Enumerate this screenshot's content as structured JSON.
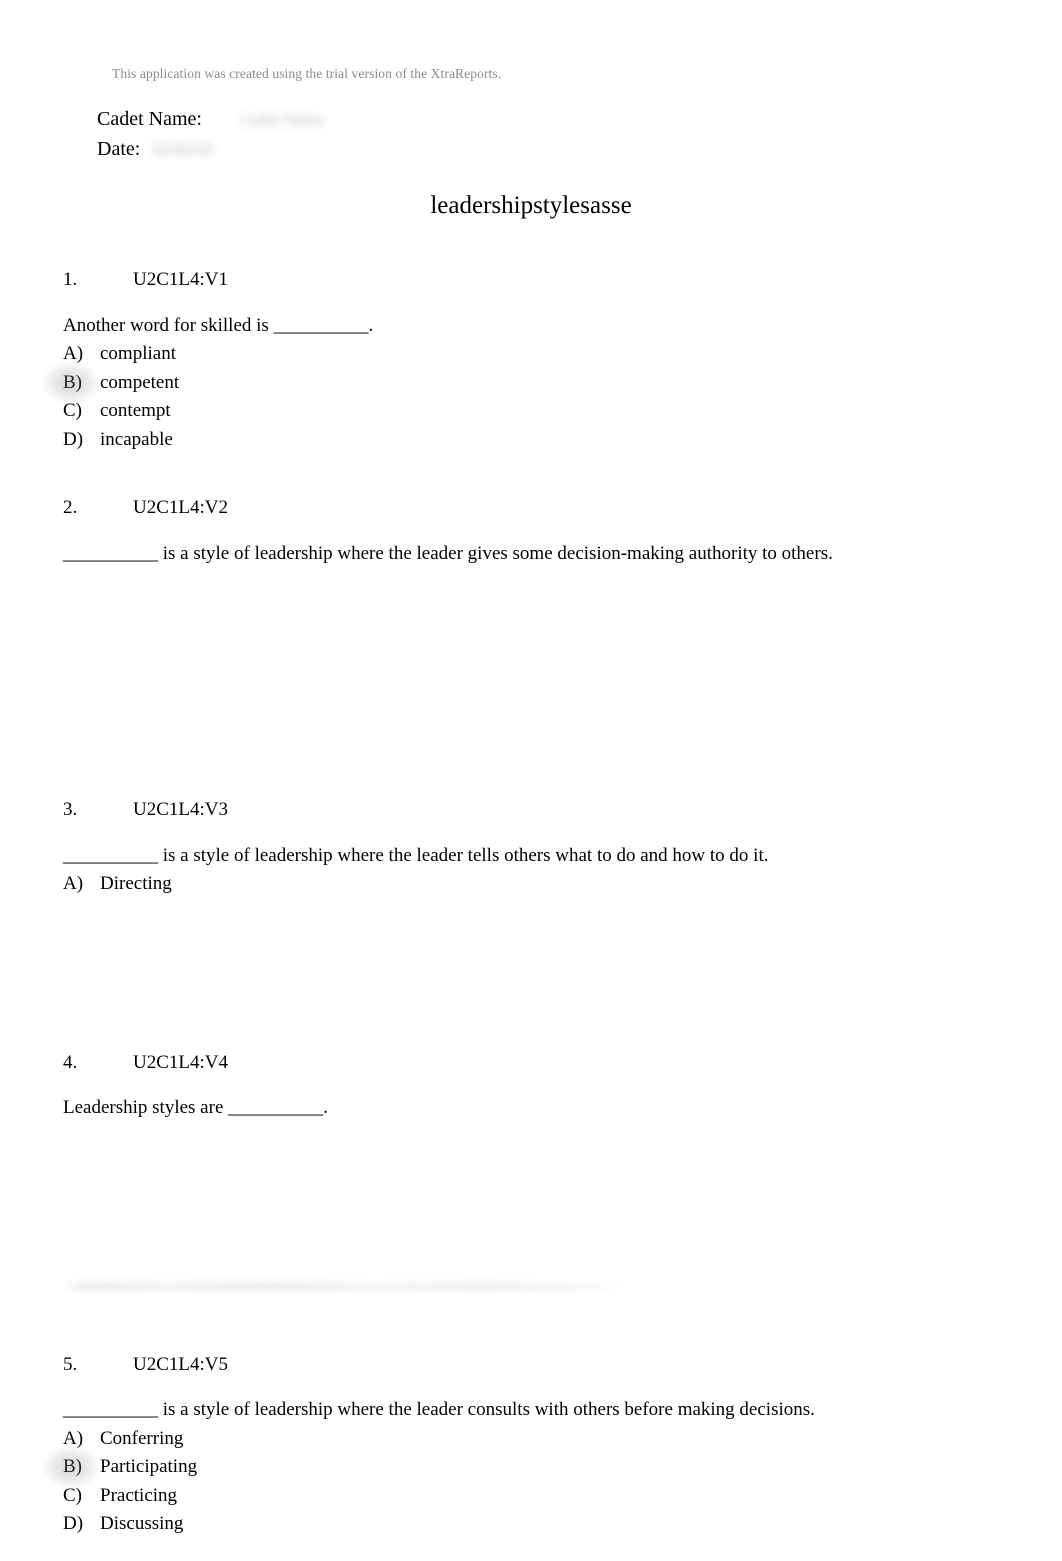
{
  "document": {
    "trial_notice": "This application was created using the trial version of the XtraReports.",
    "title": "leadershipstylesasse"
  },
  "header_fields": {
    "cadet_name": {
      "label": "Cadet Name:",
      "value": "Cadet Name",
      "redacted": true
    },
    "date": {
      "label": "Date:",
      "value": "00/00/00",
      "redacted": true
    }
  },
  "questions": [
    {
      "number": "1.",
      "code": "U2C1L4:V1",
      "stem": "Another word for skilled is __________.",
      "options": [
        {
          "letter": "A)",
          "text": "compliant",
          "marked": false
        },
        {
          "letter": "B)",
          "text": "competent",
          "marked": true
        },
        {
          "letter": "C)",
          "text": "contempt",
          "marked": false
        },
        {
          "letter": "D)",
          "text": "incapable",
          "marked": false
        }
      ]
    },
    {
      "number": "2.",
      "code": "U2C1L4:V2",
      "stem": "__________ is a style of leadership where the leader gives some decision-making authority to others.",
      "options": []
    },
    {
      "number": "3.",
      "code": "U2C1L4:V3",
      "stem": "__________ is a style of leadership where the leader tells others what to do and how to do it.",
      "options": [
        {
          "letter": "A)",
          "text": "Directing",
          "marked": false
        }
      ]
    },
    {
      "number": "4.",
      "code": "U2C1L4:V4",
      "stem": "Leadership styles are __________.",
      "options": []
    },
    {
      "number": "5.",
      "code": "U2C1L4:V5",
      "stem": "__________ is a style of leadership where the leader consults with others before making decisions.",
      "options": [
        {
          "letter": "A)",
          "text": "Conferring",
          "marked": false
        },
        {
          "letter": "B)",
          "text": "Participating",
          "marked": true
        },
        {
          "letter": "C)",
          "text": "Practicing",
          "marked": false
        },
        {
          "letter": "D)",
          "text": "Discussing",
          "marked": false
        }
      ]
    }
  ],
  "colors": {
    "page_background": "#ffffff",
    "body_text": "#000000",
    "trial_notice_text": "#8a8a8a",
    "redaction_smudge": "#b9b9b9"
  }
}
